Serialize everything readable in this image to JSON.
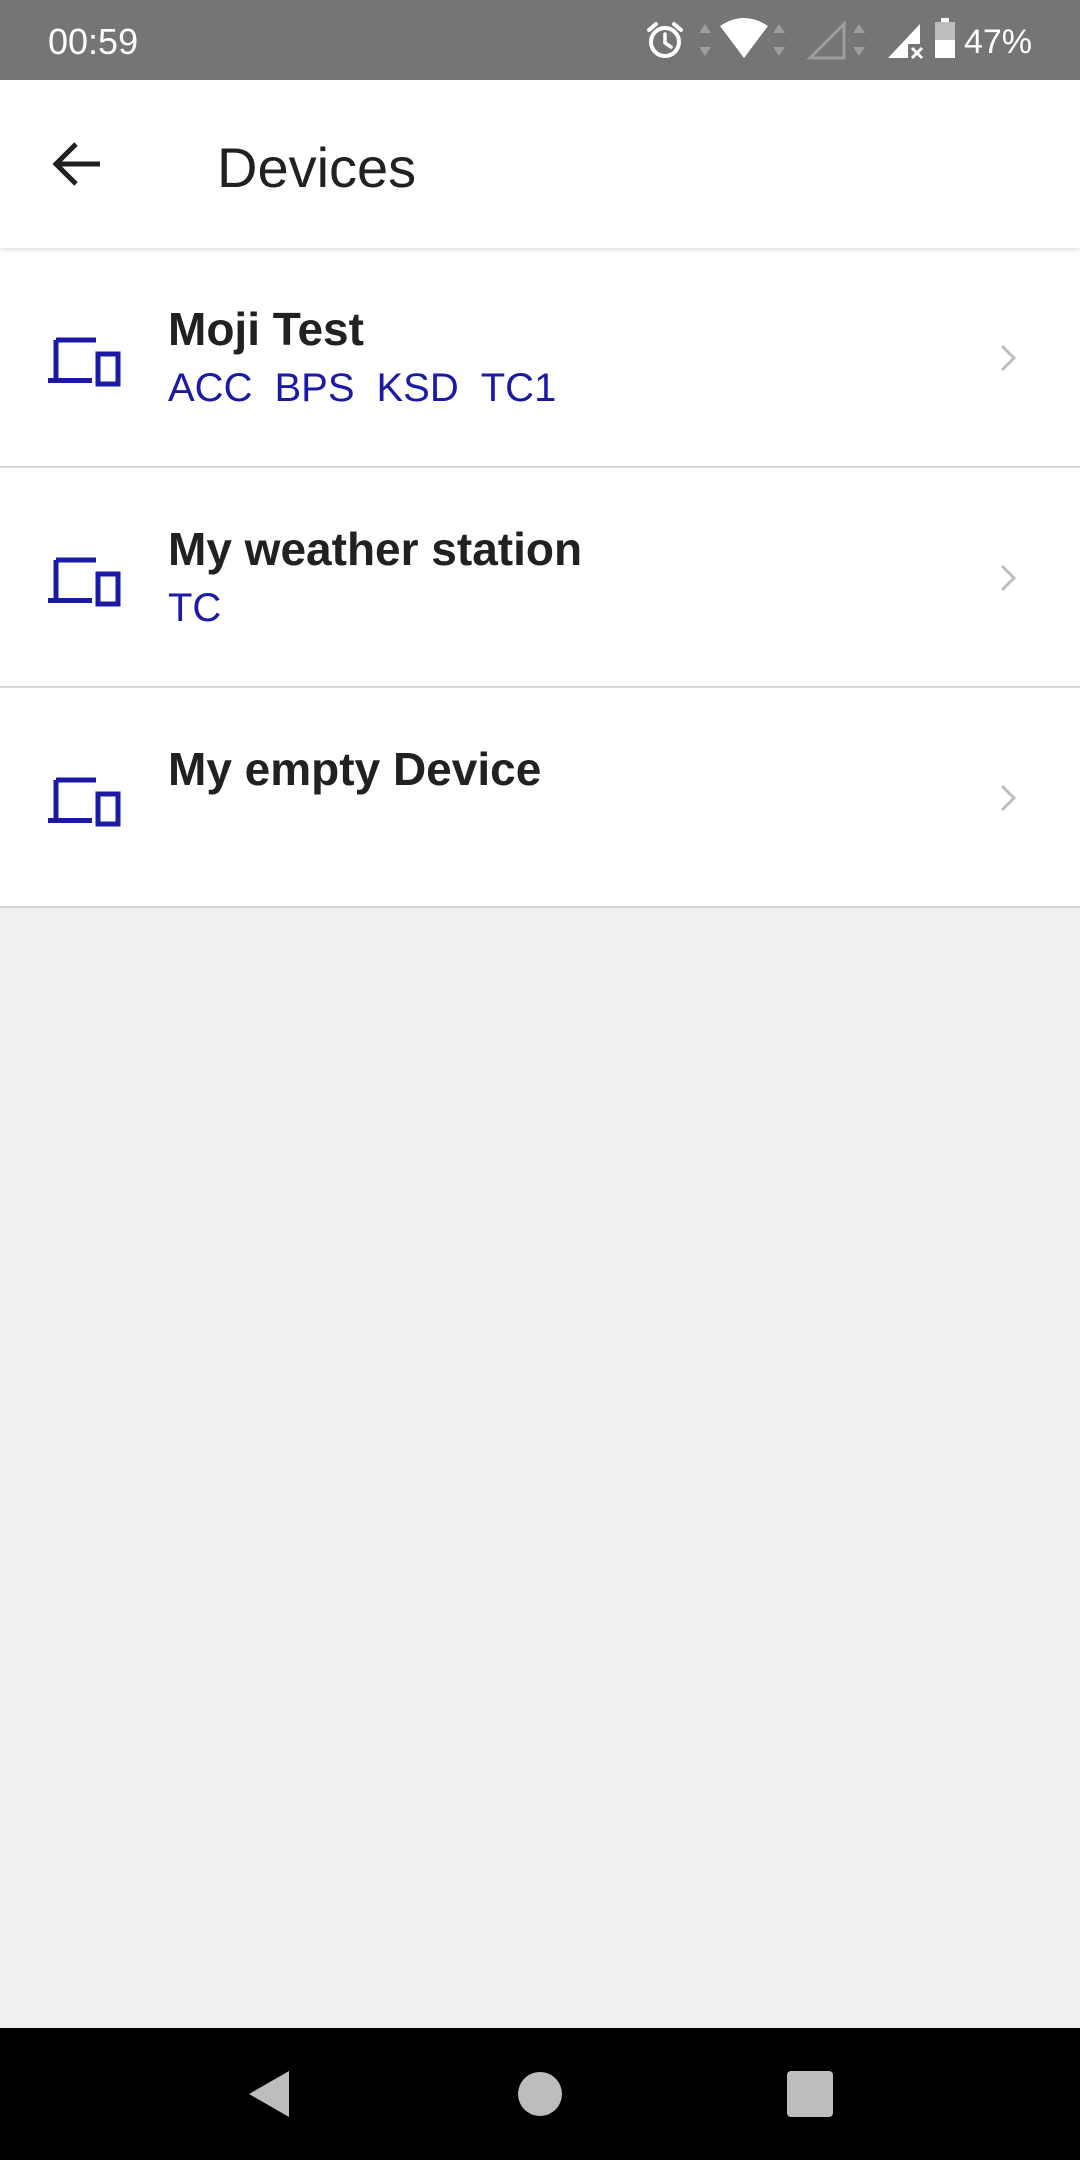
{
  "status_bar": {
    "time": "00:59",
    "battery_percent": "47%",
    "icons": [
      "alarm-icon",
      "wifi-icon",
      "signal-empty-icon",
      "signal-no-sim-icon",
      "battery-icon"
    ]
  },
  "header": {
    "title": "Devices",
    "back_icon": "arrow-back-icon"
  },
  "devices": [
    {
      "name": "Moji Test",
      "tags": [
        "ACC",
        "BPS",
        "KSD",
        "TC1"
      ]
    },
    {
      "name": "My weather station",
      "tags": [
        "TC"
      ]
    },
    {
      "name": "My empty Device",
      "tags": []
    }
  ],
  "nav_bar": {
    "back": "nav-back-icon",
    "home": "nav-home-icon",
    "recents": "nav-recents-icon"
  },
  "colors": {
    "accent": "#1a1aa6",
    "status_bar": "#757575",
    "background": "#f0f0f0"
  }
}
